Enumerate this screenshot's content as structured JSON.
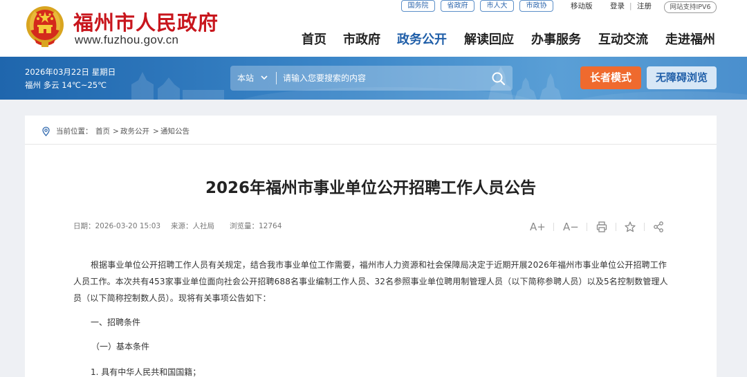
{
  "header": {
    "site_name": "福州市人民政府",
    "site_domain": "www.fuzhou.gov.cn",
    "top_links": [
      "国务院",
      "省政府",
      "市人大",
      "市政协"
    ],
    "mobile_label": "移动版",
    "login_label": "登录",
    "separator": "|",
    "register_label": "注册",
    "ipv6_label": "网站支持IPV6",
    "nav": [
      "首页",
      "市政府",
      "政务公开",
      "解读回应",
      "办事服务",
      "互动交流",
      "走进福州"
    ],
    "active_nav": "政务公开"
  },
  "banner": {
    "date": "2026年03月22日 星期日",
    "weather": "福州 多云 14℃~25℃",
    "search_scope": "本站",
    "search_placeholder": "请输入您要搜索的内容",
    "elder_mode": "长者模式",
    "accessibility": "无障碍浏览"
  },
  "breadcrumb": {
    "prefix": "当前位置：",
    "items": [
      "首页",
      "政务公开",
      "通知公告"
    ],
    "separator": ">"
  },
  "article": {
    "title": "2026年福州市事业单位公开招聘工作人员公告",
    "date": "日期：2026-03-20 15:03",
    "source": "来源：人社局",
    "views": "浏览量：12764",
    "tools": [
      "A+",
      "A−"
    ],
    "paragraph1": "根据事业单位公开招聘工作人员有关规定，结合我市事业单位工作需要，福州市人力资源和社会保障局决定于近期开展2026年福州市事业单位公开招聘工作人员工作。本次共有453家事业单位面向社会公开招聘688名事业编制工作人员、32名参照事业单位聘用制管理人员（以下简称参聘人员）以及5名控制数管理人员（以下简称控制数人员）。现将有关事项公告如下：",
    "heading1": "一、招聘条件",
    "heading2": "（一）基本条件",
    "item1": "1. 具有中华人民共和国国籍；"
  },
  "colors": {
    "brand_red": "#c8161d",
    "nav_active": "#1f5ea8",
    "banner_blue": "#2f77bb",
    "elder_orange": "#ef6a2e"
  },
  "icons": [
    "national-emblem-icon",
    "chevron-down-icon",
    "search-icon",
    "location-icon",
    "print-icon",
    "star-icon",
    "share-icon"
  ]
}
